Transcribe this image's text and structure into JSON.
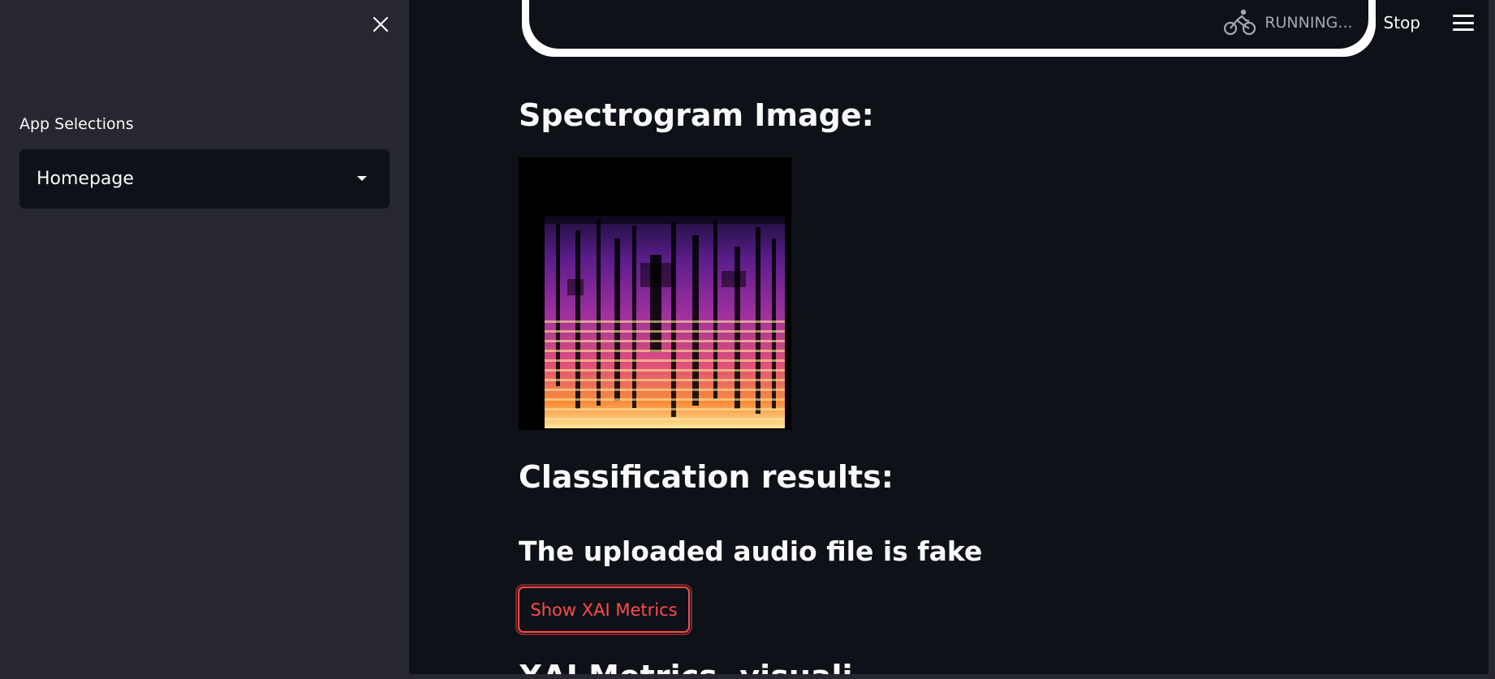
{
  "sidebar": {
    "label": "App Selections",
    "select_value": "Homepage"
  },
  "header": {
    "status_text": "RUNNING...",
    "stop_label": "Stop"
  },
  "main": {
    "spectrogram_heading": "Spectrogram Image:",
    "classification_heading": "Classification results:",
    "result_text": "The uploaded audio file is fake",
    "xai_button_label": "Show XAI Metrics",
    "cut_heading": "XAI Metrics, visuali..."
  },
  "colors": {
    "background": "#0e1117",
    "sidebar": "#262730",
    "accent": "#ff4b4b",
    "text": "#fafafa"
  },
  "icons": [
    "close-icon",
    "caret-down-icon",
    "bicycle-running-icon",
    "hamburger-menu-icon"
  ]
}
